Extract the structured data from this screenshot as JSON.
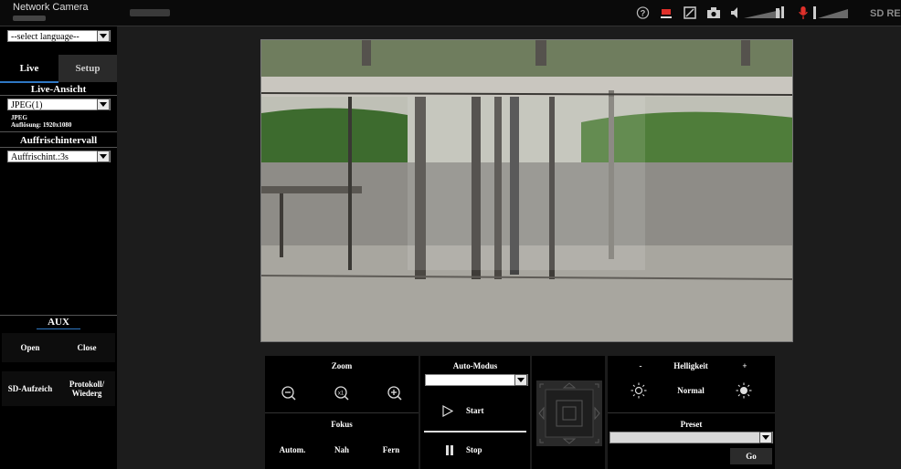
{
  "header": {
    "brand": "Network Camera",
    "sd_rec": "SD REC",
    "icons": [
      "help-icon",
      "record-indicator-icon",
      "snapshot-list-icon",
      "camera-icon",
      "speaker-icon",
      "volume-bars-icon",
      "microphone-icon",
      "mic-level-bars-icon"
    ]
  },
  "sidebar": {
    "language_select": "--select language--",
    "tabs": {
      "live": "Live",
      "setup": "Setup"
    },
    "live_view_title": "Live-Ansicht",
    "stream_select": "JPEG(1)",
    "stream_format": "JPEG",
    "stream_resolution": "Auflösung: 1920x1080",
    "refresh_title": "Auffrischintervall",
    "refresh_select": "Auffrischint.:3s",
    "aux_title": "AUX",
    "aux_open": "Open",
    "aux_close": "Close",
    "sd_record": "SD-Aufzeich",
    "log_replay_line1": "Protokoll/",
    "log_replay_line2": "Wiederg"
  },
  "controls": {
    "zoom_title": "Zoom",
    "focus_title": "Fokus",
    "focus_auto": "Autom.",
    "focus_near": "Nah",
    "focus_far": "Fern",
    "auto_mode_title": "Auto-Modus",
    "auto_mode_select": "",
    "start": "Start",
    "stop": "Stop",
    "brightness_minus": "-",
    "brightness_title": "Helligkeit",
    "brightness_plus": "+",
    "brightness_normal": "Normal",
    "preset_title": "Preset",
    "preset_select": "",
    "go": "Go"
  },
  "colors": {
    "background": "#1c1c1c",
    "panel": "#000000",
    "record_red": "#e0302a",
    "tab_underline": "#2f78c4"
  }
}
